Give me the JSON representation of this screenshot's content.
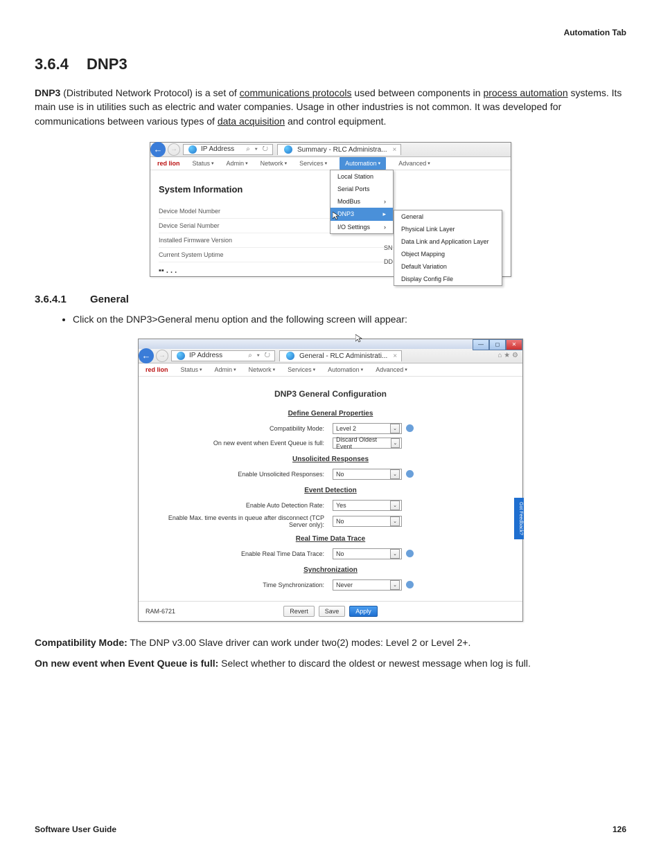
{
  "header": {
    "tab_label": "Automation Tab"
  },
  "section": {
    "num": "3.6.4",
    "title": "DNP3"
  },
  "intro": {
    "strong": "DNP3",
    "t1": " (Distributed Network Protocol) is a set of ",
    "l1": "communications protocols",
    "t2": " used between components in ",
    "l2": "process automation",
    "t3": " systems. Its main use is in utilities such as electric and water companies. Usage in other industries is not common. It was developed for communications between various types of ",
    "l3": "data acquisition",
    "t4": " and control equipment."
  },
  "shot1": {
    "addr": "IP Address",
    "addr_icons": "⌕ ▾ ↻",
    "tab": "Summary - RLC Administra...",
    "brand": "red lion",
    "menu": [
      "Status",
      "Admin",
      "Network",
      "Services",
      "Automation",
      "Advanced"
    ],
    "heading": "System Information",
    "rows": [
      "Device Model Number",
      "Device Serial Number",
      "Installed Firmware Version",
      "Current System Uptime"
    ],
    "badge1": "SN",
    "badge2": "DD",
    "dd1": [
      "Local Station",
      "Serial Ports",
      "ModBus",
      "DNP3",
      "I/O Settings"
    ],
    "dd2": [
      "General",
      "Physical Link Layer",
      "Data Link and Application Layer",
      "Object Mapping",
      "Default Variation",
      "Display Config File"
    ]
  },
  "sub": {
    "num": "3.6.4.1",
    "title": "General"
  },
  "bullet": "Click on the DNP3>General menu option and the following screen will appear:",
  "shot2": {
    "addr": "IP Address",
    "addr_icons": "⌕ ▾ ↻",
    "tab": "General - RLC Administrati...",
    "menu": [
      "Status",
      "Admin",
      "Network",
      "Services",
      "Automation",
      "Advanced"
    ],
    "brand": "red lion",
    "title": "DNP3 General Configuration",
    "sec1": "Define General Properties",
    "f1_l": "Compatibility Mode:",
    "f1_v": "Level 2",
    "f2_l": "On new event when Event Queue is full:",
    "f2_v": "Discard Oldest Event",
    "sec2": "Unsolicited Responses",
    "f3_l": "Enable Unsolicited Responses:",
    "f3_v": "No",
    "sec3": "Event Detection",
    "f4_l": "Enable Auto Detection Rate:",
    "f4_v": "Yes",
    "f5_l": "Enable Max. time events in queue after disconnect (TCP Server only):",
    "f5_v": "No",
    "sec4": "Real Time Data Trace",
    "f6_l": "Enable Real Time Data Trace:",
    "f6_v": "No",
    "sec5": "Synchronization",
    "f7_l": "Time Synchronization:",
    "f7_v": "Never",
    "model": "RAM-6721",
    "btn_revert": "Revert",
    "btn_save": "Save",
    "btn_apply": "Apply",
    "feedback": "Got Feedback?"
  },
  "desc": {
    "d1_b": "Compatibility Mode:",
    "d1_t": " The DNP v3.00 Slave driver can work under two(2) modes: Level 2 or Level 2+.",
    "d2_b": "On new event when Event Queue is full:",
    "d2_t": " Select whether to discard the oldest or newest message when log is full."
  },
  "footer": {
    "left": "Software User Guide",
    "right": "126"
  }
}
